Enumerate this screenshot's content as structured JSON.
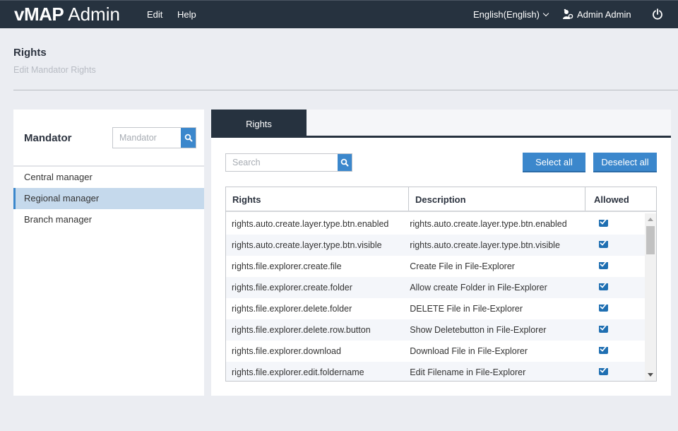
{
  "topbar": {
    "brand_bold": "vMAP",
    "brand_light": "Admin",
    "menu": [
      "Edit",
      "Help"
    ],
    "language": "English(English)",
    "user": "Admin Admin",
    "icons": {
      "language": "chevron-down-icon",
      "user": "user-settings-icon",
      "power": "power-icon"
    }
  },
  "page": {
    "title": "Rights",
    "subtitle": "Edit Mandator Rights"
  },
  "mandator": {
    "title": "Mandator",
    "search_placeholder": "Mandator",
    "items": [
      {
        "label": "Central manager",
        "active": false
      },
      {
        "label": "Regional manager",
        "active": true
      },
      {
        "label": "Branch manager",
        "active": false
      }
    ]
  },
  "rights_panel": {
    "tab": "Rights",
    "search_placeholder": "Search",
    "select_all": "Select all",
    "deselect_all": "Deselect all",
    "columns": [
      "Rights",
      "Description",
      "Allowed"
    ],
    "rows": [
      {
        "right": "rights.auto.create.layer.type.btn.enabled",
        "description": "rights.auto.create.layer.type.btn.enabled",
        "allowed": true
      },
      {
        "right": "rights.auto.create.layer.type.btn.visible",
        "description": "rights.auto.create.layer.type.btn.visible",
        "allowed": true
      },
      {
        "right": "rights.file.explorer.create.file",
        "description": "Create File in File-Explorer",
        "allowed": true
      },
      {
        "right": "rights.file.explorer.create.folder",
        "description": "Allow create Folder in File-Explorer",
        "allowed": true
      },
      {
        "right": "rights.file.explorer.delete.folder",
        "description": "DELETE File in File-Explorer",
        "allowed": true
      },
      {
        "right": "rights.file.explorer.delete.row.button",
        "description": "Show Deletebutton in File-Explorer",
        "allowed": true
      },
      {
        "right": "rights.file.explorer.download",
        "description": "Download File in File-Explorer",
        "allowed": true
      },
      {
        "right": "rights.file.explorer.edit.foldername",
        "description": "Edit Filename in File-Explorer",
        "allowed": true
      }
    ]
  },
  "colors": {
    "topbar": "#26323f",
    "accent": "#3b87cc",
    "active_row": "#c5d9ec",
    "checkbox": "#1f6fb2"
  }
}
